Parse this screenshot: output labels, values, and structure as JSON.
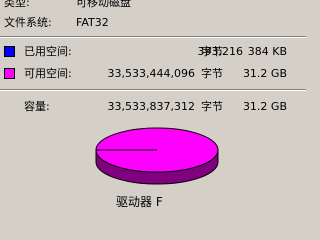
{
  "properties": {
    "type_label": "类型:",
    "type_value": "可移动磁盘",
    "fs_label": "文件系统:",
    "fs_value": "FAT32"
  },
  "usage": {
    "used": {
      "label": "已用空间:",
      "bytes": "393,216",
      "unit": "字节",
      "size": "384 KB",
      "color": "#0000ff"
    },
    "free": {
      "label": "可用空间:",
      "bytes": "33,533,444,096",
      "unit": "字节",
      "size": "31.2 GB",
      "color": "#ff00ff"
    },
    "capacity": {
      "label": "容量:",
      "bytes": "33,533,837,312",
      "unit": "字节",
      "size": "31.2 GB"
    }
  },
  "drive": {
    "label": "驱动器 F"
  }
}
